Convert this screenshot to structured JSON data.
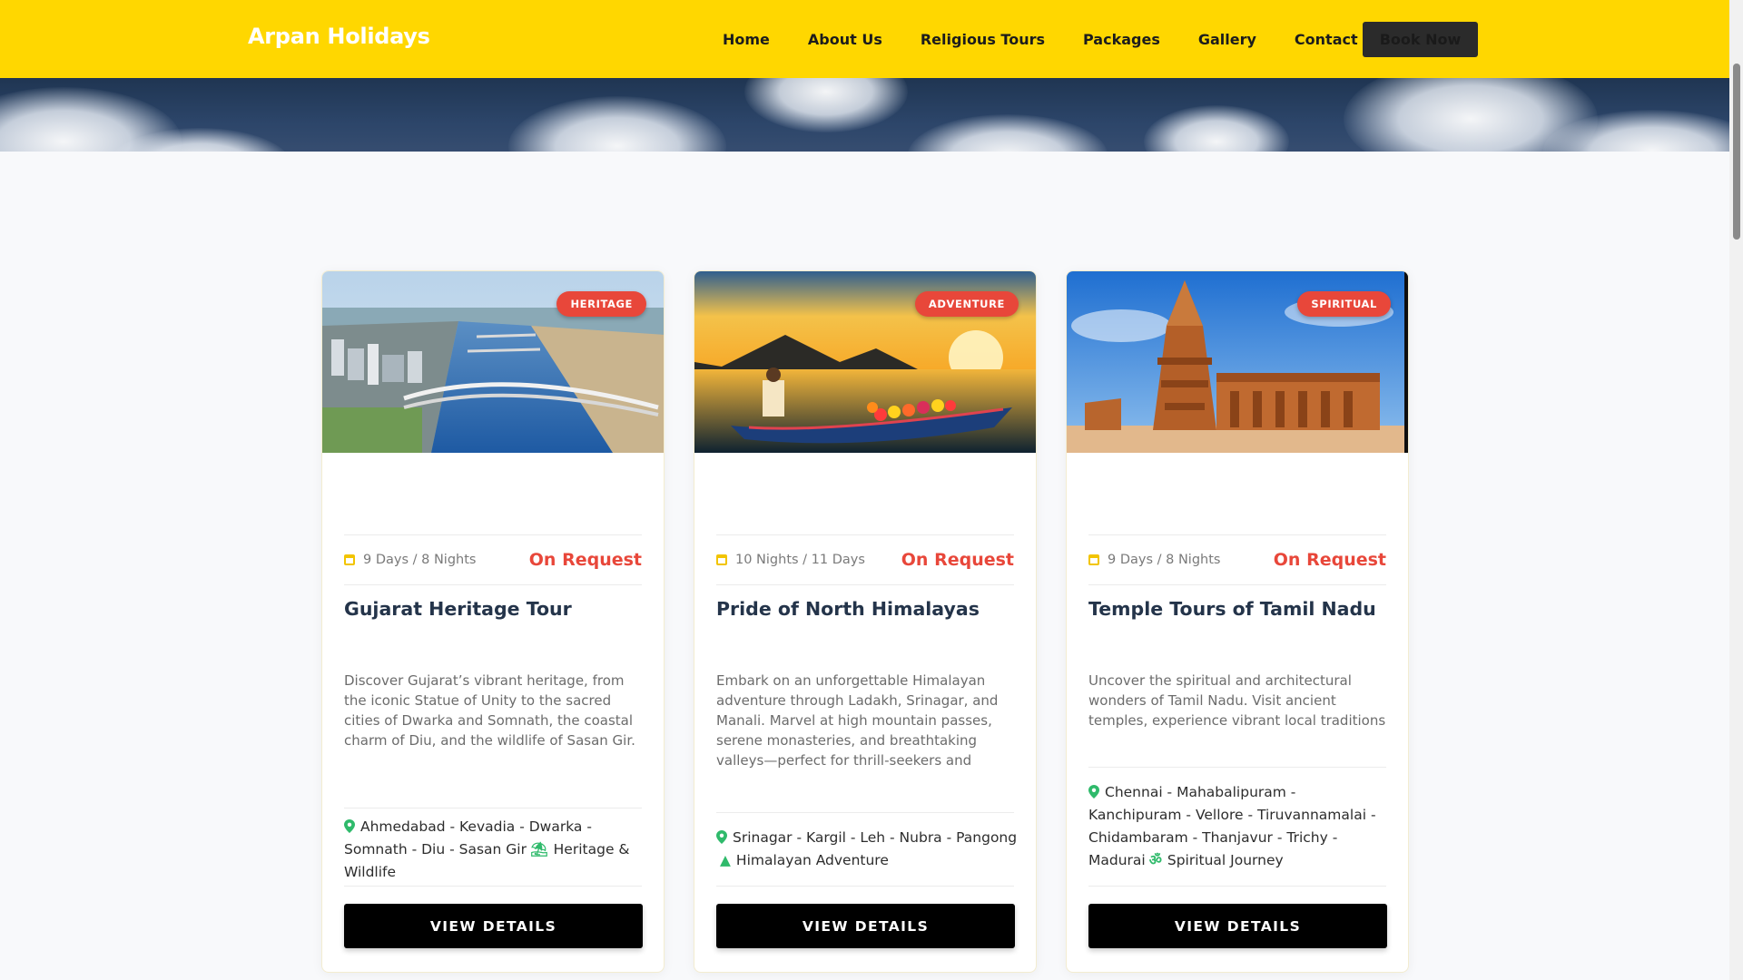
{
  "header": {
    "brand": "Arpan Holidays",
    "nav": [
      "Home",
      "About Us",
      "Religious Tours",
      "Packages",
      "Gallery",
      "Contact"
    ],
    "book_now": "Book Now"
  },
  "colors": {
    "header_bg": "#ffd700",
    "badge_bg": "#e8473a",
    "price": "#e8473a",
    "button_bg": "#000000",
    "accent_green": "#2fba6b"
  },
  "cards": [
    {
      "badge": "HERITAGE",
      "image": "ahmedabad-riverfront-bridge",
      "duration": "9 Days / 8 Nights",
      "price": "On Request",
      "title": "Gujarat Heritage Tour",
      "description": "Discover Gujarat’s vibrant heritage, from the iconic Statue of Unity to the sacred cities of Dwarka and Somnath, the coastal charm of Diu, and the wildlife of Sasan Gir. Experience centuries of culture, spirituality",
      "route": "Ahmedabad - Kevadia - Dwarka - Somnath - Diu - Sasan Gir",
      "theme_icon": "beach-umbrella-icon",
      "theme": "Heritage & Wildlife",
      "button": "VIEW DETAILS"
    },
    {
      "badge": "ADVENTURE",
      "image": "dal-lake-shikara-sunset",
      "duration": "10 Nights / 11 Days",
      "price": "On Request",
      "title": "Pride of North Himalayas",
      "description": "Embark on an unforgettable Himalayan adventure through Ladakh, Srinagar, and Manali. Marvel at high mountain passes, serene monasteries, and breathtaking valleys—perfect for thrill-seekers and nature lovers",
      "route": "Srinagar - Kargil - Leh - Nubra - Pangong",
      "theme_icon": "mountain-icon",
      "theme": "Himalayan Adventure",
      "button": "VIEW DETAILS"
    },
    {
      "badge": "SPIRITUAL",
      "image": "brihadeeswarar-temple",
      "duration": "9 Days / 8 Nights",
      "price": "On Request",
      "title": "Temple Tours of Tamil Nadu",
      "description": "Uncover the spiritual and architectural wonders of Tamil Nadu. Visit ancient temples, experience vibrant local traditions and cultural",
      "route": "Chennai - Mahabalipuram - Kanchipuram - Vellore - Tiruvannamalai - Chidambaram - Thanjavur - Trichy - Madurai",
      "theme_icon": "om-icon",
      "theme": "Spiritual Journey",
      "button": "VIEW DETAILS"
    }
  ]
}
